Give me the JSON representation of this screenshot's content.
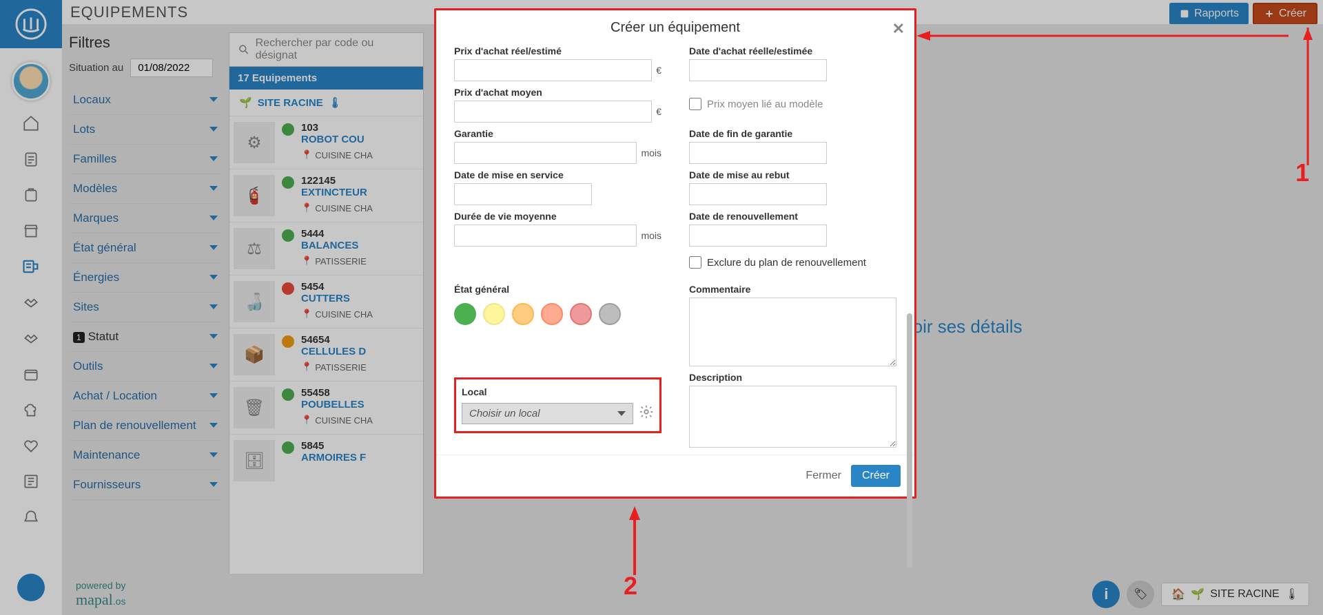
{
  "page_title": "EQUIPEMENTS",
  "top_actions": {
    "reports": "Rapports",
    "create": "Créer"
  },
  "filters": {
    "heading": "Filtres",
    "situation_label": "Situation au",
    "situation_date": "01/08/2022",
    "items": [
      "Locaux",
      "Lots",
      "Familles",
      "Modèles",
      "Marques",
      "État général",
      "Énergies",
      "Sites",
      "Statut",
      "Outils",
      "Achat / Location",
      "Plan de renouvellement",
      "Maintenance",
      "Fournisseurs"
    ],
    "statut_count": "1"
  },
  "search_placeholder": "Rechercher par code ou désignat",
  "list_header": "17 Equipements",
  "site_root": "SITE RACINE",
  "equipments": [
    {
      "code": "103",
      "name": "ROBOT COU",
      "loc": "CUISINE CHA",
      "status": "#4caf50",
      "thumb": "⚙"
    },
    {
      "code": "122145",
      "name": "EXTINCTEUR",
      "loc": "CUISINE CHA",
      "status": "#4caf50",
      "thumb": "🧯"
    },
    {
      "code": "5444",
      "name": "BALANCES",
      "loc": "PATISSERIE",
      "status": "#4caf50",
      "thumb": "⚖"
    },
    {
      "code": "5454",
      "name": "CUTTERS",
      "loc": "CUISINE CHA",
      "status": "#e74c3c",
      "thumb": "🍶"
    },
    {
      "code": "54654",
      "name": "CELLULES D",
      "loc": "PATISSERIE",
      "status": "#f39c12",
      "thumb": "📦"
    },
    {
      "code": "55458",
      "name": "POUBELLES",
      "loc": "CUISINE CHA",
      "status": "#4caf50",
      "thumb": "🗑"
    },
    {
      "code": "5845",
      "name": "ARMOIRES F",
      "loc": "",
      "status": "#4caf50",
      "thumb": "🗄"
    }
  ],
  "detail_prompt": "ir un équipement pour voir ses détails",
  "modal": {
    "title": "Créer un équipement",
    "labels": {
      "prix_reel": "Prix d'achat réel/estimé",
      "date_achat": "Date d'achat réelle/estimée",
      "prix_moyen": "Prix d'achat moyen",
      "prix_moyen_chk": "Prix moyen lié au modèle",
      "garantie": "Garantie",
      "date_fin_garantie": "Date de fin de garantie",
      "date_service": "Date de mise en service",
      "date_rebut": "Date de mise au rebut",
      "duree_vie": "Durée de vie moyenne",
      "date_renouv": "Date de renouvellement",
      "exclure_chk": "Exclure du plan de renouvellement",
      "etat": "État général",
      "commentaire": "Commentaire",
      "local": "Local",
      "local_placeholder": "Choisir un local",
      "description": "Description"
    },
    "units": {
      "euro": "€",
      "mois": "mois"
    },
    "footer": {
      "close": "Fermer",
      "create": "Créer"
    }
  },
  "footer": {
    "powered_pre": "powered by",
    "powered_brand": "mapal",
    "powered_suffix": ".os",
    "site": "SITE RACINE"
  },
  "annotations": {
    "n1": "1",
    "n2": "2"
  }
}
